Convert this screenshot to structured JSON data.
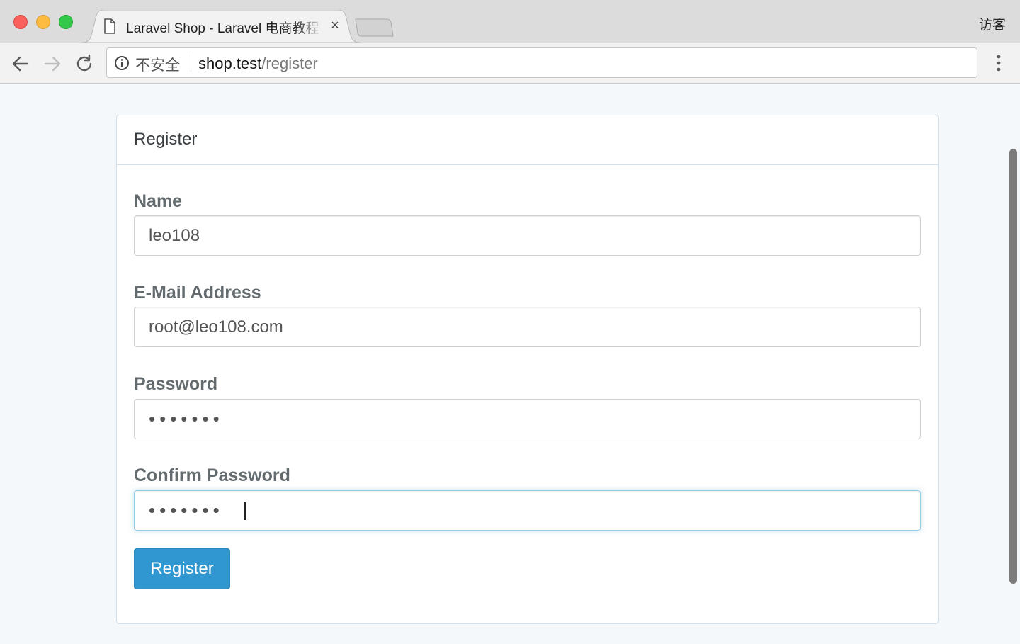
{
  "browser": {
    "tab": {
      "title": "Laravel Shop - Laravel 电商教程",
      "close": "×"
    },
    "profile_label": "访客",
    "address_bar": {
      "security_label": "不安全",
      "host": "shop.test",
      "path": "/register"
    },
    "icons": [
      "back-arrow-icon",
      "forward-arrow-icon",
      "reload-icon",
      "info-icon",
      "document-icon",
      "menu-dots-icon"
    ]
  },
  "register_form": {
    "title": "Register",
    "fields": {
      "name": {
        "label": "Name",
        "value": "leo108"
      },
      "email": {
        "label": "E-Mail Address",
        "value": "root@leo108.com"
      },
      "password": {
        "label": "Password",
        "value": "•••••••"
      },
      "password_confirm": {
        "label": "Confirm Password",
        "value": "•••••••"
      }
    },
    "submit_label": "Register"
  },
  "colors": {
    "page_background": "#f5f8fa",
    "primary_button": "#3097d1",
    "label_text": "#636b6f",
    "card_border": "#d3e0e9"
  }
}
